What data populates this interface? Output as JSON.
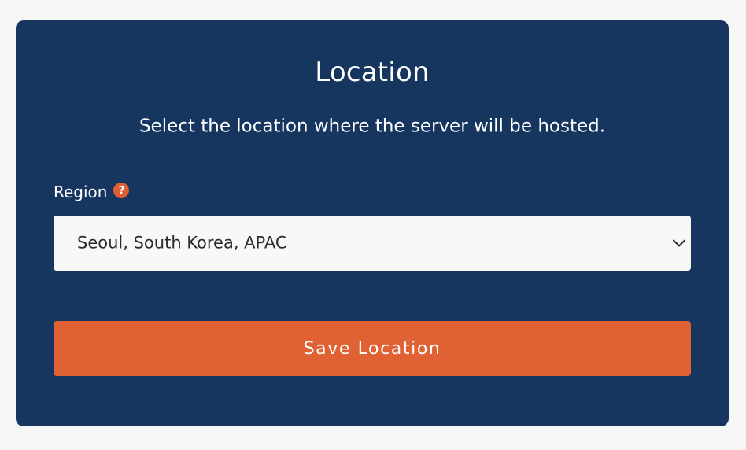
{
  "card": {
    "title": "Location",
    "subtitle": "Select the location where the server will be hosted."
  },
  "region": {
    "label": "Region",
    "help_icon_text": "?",
    "selected_value": "Seoul, South Korea, APAC"
  },
  "actions": {
    "save_label": "Save Location"
  },
  "colors": {
    "page_background": "#f7f7f7",
    "card_background": "#163660",
    "accent": "#e06133",
    "select_background": "#f8f8f8",
    "text_light": "#ffffff",
    "text_dark": "#2b2b2b"
  },
  "icons": {
    "help": "question-circle-icon",
    "dropdown": "chevron-down-icon"
  }
}
